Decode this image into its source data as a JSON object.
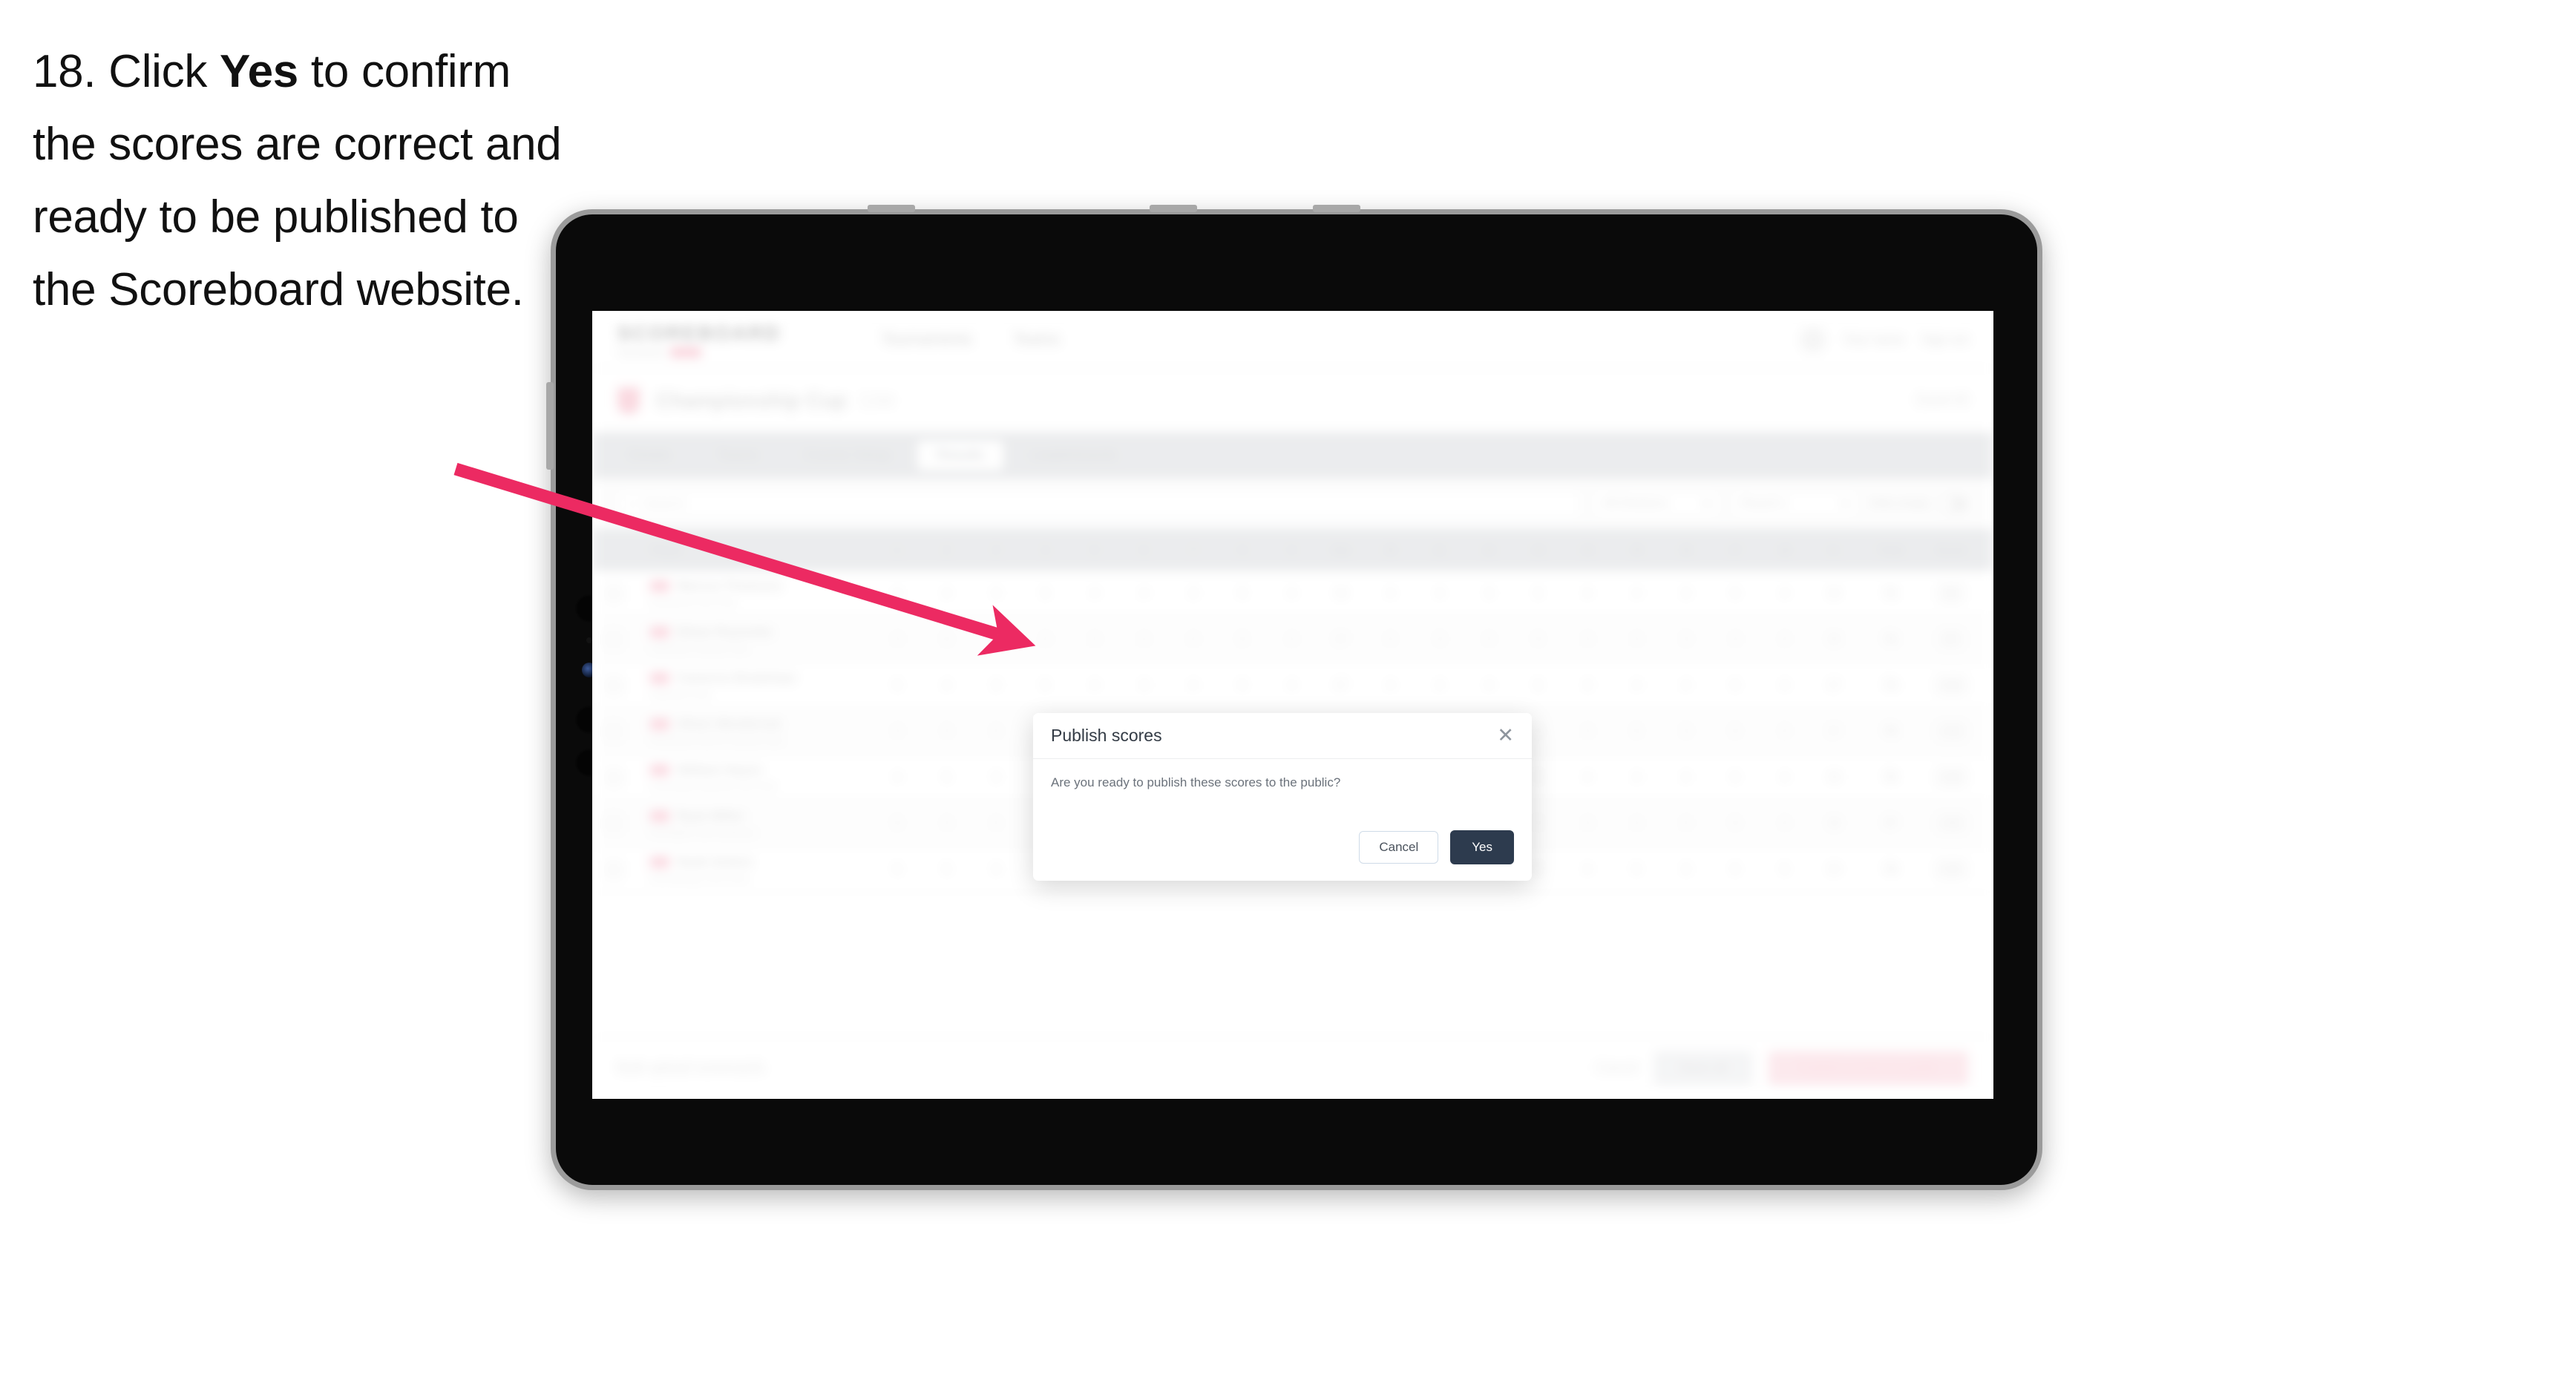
{
  "instruction": {
    "number": "18.",
    "text_before": " Click ",
    "emphasis": "Yes",
    "text_after": " to confirm the scores are correct and ready to be published to the Scoreboard website."
  },
  "colors": {
    "arrow": "#EC2A62",
    "primary_button": "#2d3b4e",
    "brand_pink": "#f7aebe",
    "tab_bar": "#d9dbde"
  },
  "app": {
    "brand": {
      "name": "SCOREBOARD",
      "sub": "Tournament",
      "badge": "PRO"
    },
    "header_nav": [
      "Tournaments",
      "Teams"
    ],
    "header_right": {
      "avatar": "avatar",
      "user": "Your name",
      "signout": "Sign out"
    },
    "event": {
      "title": "Championship Cup",
      "status": "Live",
      "right": "Event ID"
    },
    "tabs": [
      {
        "label": "Details",
        "active": false
      },
      {
        "label": "Teams",
        "active": false
      },
      {
        "label": "Course Setup",
        "active": false
      },
      {
        "label": "Results",
        "active": true
      },
      {
        "label": "Leaderboards",
        "active": false
      }
    ],
    "filters": {
      "search_placeholder": "Search",
      "selects": [
        "All Divisions",
        "Round 1"
      ],
      "toggle_label": "Hide empty"
    },
    "table": {
      "headers": {
        "player": "Player",
        "holes": [
          "1",
          "2",
          "3",
          "4",
          "5",
          "6",
          "7",
          "8",
          "9",
          "Out",
          "10",
          "11",
          "12",
          "13",
          "14",
          "15",
          "16",
          "17",
          "18",
          "In"
        ],
        "total": "Total",
        "score": "Score"
      },
      "rows": [
        {
          "flag": "flag",
          "name": "Marcus Thomson",
          "sub": "Eastwood Golf Club",
          "holes": [
            "4",
            "4",
            "3",
            "5",
            "4",
            "4",
            "3",
            "5",
            "4",
            "36",
            "4",
            "4",
            "3",
            "5",
            "4",
            "4",
            "3",
            "5",
            "4",
            "36"
          ],
          "total": "72",
          "score": "E"
        },
        {
          "flag": "flag",
          "name": "Ethan Reynolds",
          "sub": "Lakeside Country Club",
          "holes": [
            "4",
            "5",
            "3",
            "4",
            "4",
            "4",
            "4",
            "5",
            "4",
            "37",
            "4",
            "3",
            "4",
            "5",
            "4",
            "4",
            "3",
            "4",
            "4",
            "35"
          ],
          "total": "72",
          "score": "E"
        },
        {
          "flag": "flag",
          "name": "Cameron Bradshaw",
          "sub": "Highland Park",
          "holes": [
            "5",
            "4",
            "3",
            "5",
            "4",
            "3",
            "4",
            "5",
            "4",
            "37",
            "4",
            "4",
            "4",
            "5",
            "3",
            "4",
            "4",
            "5",
            "4",
            "37"
          ],
          "total": "74",
          "score": "+2"
        },
        {
          "flag": "flag",
          "name": "Oliver Westbrook",
          "sub": "Riverbend Golf & Country Club",
          "holes": [
            "4",
            "4",
            "4",
            "5",
            "4",
            "4",
            "3",
            "5",
            "5",
            "38",
            "4",
            "4",
            "3",
            "5",
            "4",
            "5",
            "3",
            "5",
            "4",
            "37"
          ],
          "total": "75",
          "score": "+3"
        },
        {
          "flag": "flag",
          "name": "William Hayes",
          "sub": "Greenfield National Golf Club",
          "holes": [
            "4",
            "5",
            "3",
            "5",
            "4",
            "4",
            "4",
            "5",
            "4",
            "38",
            "5",
            "4",
            "3",
            "5",
            "4",
            "4",
            "4",
            "5",
            "4",
            "38"
          ],
          "total": "76",
          "score": "+4"
        },
        {
          "flag": "flag",
          "name": "Ryan Miller",
          "sub": "Northgate Golf Academy",
          "holes": [
            "5",
            "4",
            "4",
            "5",
            "4",
            "4",
            "3",
            "6",
            "4",
            "39",
            "4",
            "4",
            "4",
            "5",
            "4",
            "4",
            "4",
            "5",
            "4",
            "38"
          ],
          "total": "77",
          "score": "+5"
        },
        {
          "flag": "flag",
          "name": "Noah Sutton",
          "sub": "Stonebridge Golf Links",
          "holes": [
            "5",
            "5",
            "3",
            "5",
            "5",
            "4",
            "4",
            "5",
            "4",
            "40",
            "4",
            "5",
            "3",
            "5",
            "4",
            "5",
            "3",
            "5",
            "5",
            "39"
          ],
          "total": "79",
          "score": "+7"
        }
      ]
    },
    "actions": {
      "bulk_link": "Bulk upload scorecards",
      "cancel": "Cancel",
      "save": "Save all",
      "publish": "Publish scores to public"
    }
  },
  "modal": {
    "title": "Publish scores",
    "message": "Are you ready to publish these scores to the public?",
    "close_icon": "close-icon",
    "cancel_label": "Cancel",
    "confirm_label": "Yes"
  }
}
